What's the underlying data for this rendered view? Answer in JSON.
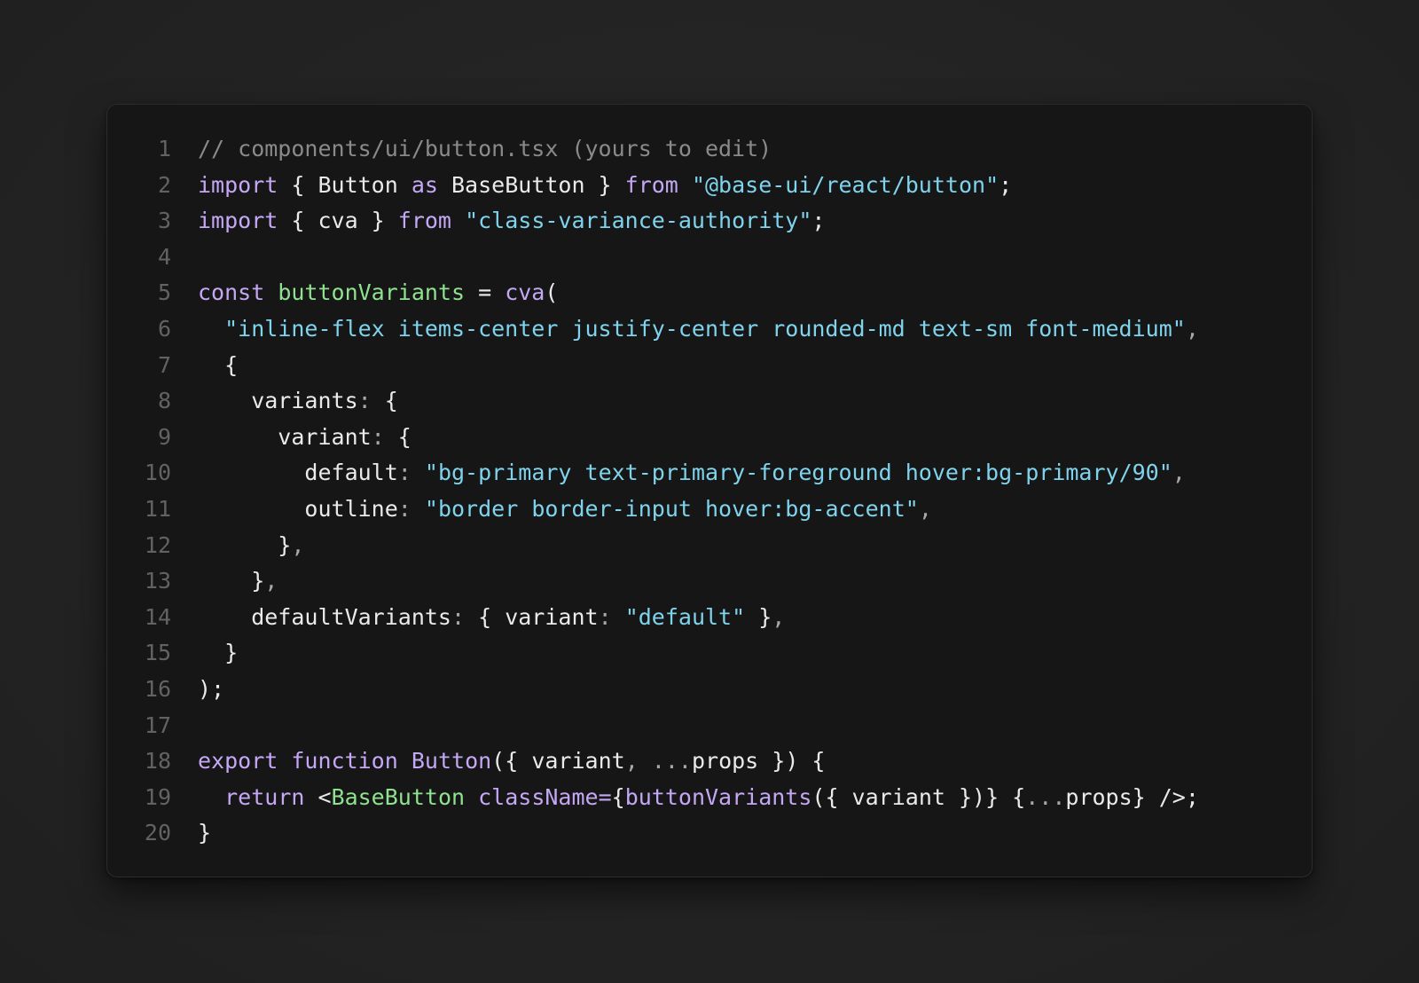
{
  "colors": {
    "page_background": "#242424",
    "card_background": "#161616",
    "line_number": "#626262",
    "comment": "#8a8a8a",
    "keyword": "#c4a7f5",
    "string": "#7fd3ec",
    "identifier": "#eaeaea",
    "declaration": "#8fe28f"
  },
  "lines": [
    {
      "n": "1",
      "tokens": [
        {
          "t": "// components/ui/button.tsx (yours to edit)",
          "k": "comment"
        }
      ]
    },
    {
      "n": "2",
      "tokens": [
        {
          "t": "import",
          "k": "keyword"
        },
        {
          "t": " { Button ",
          "k": "ident"
        },
        {
          "t": "as",
          "k": "keyword"
        },
        {
          "t": " BaseButton } ",
          "k": "ident"
        },
        {
          "t": "from",
          "k": "keyword"
        },
        {
          "t": " ",
          "k": "ident"
        },
        {
          "t": "\"@base-ui/react/button\"",
          "k": "string"
        },
        {
          "t": ";",
          "k": "ident"
        }
      ]
    },
    {
      "n": "3",
      "tokens": [
        {
          "t": "import",
          "k": "keyword"
        },
        {
          "t": " { cva } ",
          "k": "ident"
        },
        {
          "t": "from",
          "k": "keyword"
        },
        {
          "t": " ",
          "k": "ident"
        },
        {
          "t": "\"class-variance-authority\"",
          "k": "string"
        },
        {
          "t": ";",
          "k": "ident"
        }
      ]
    },
    {
      "n": "4",
      "tokens": []
    },
    {
      "n": "5",
      "tokens": [
        {
          "t": "const",
          "k": "keyword"
        },
        {
          "t": " ",
          "k": "ident"
        },
        {
          "t": "buttonVariants",
          "k": "decl"
        },
        {
          "t": " = ",
          "k": "ident"
        },
        {
          "t": "cva",
          "k": "call"
        },
        {
          "t": "(",
          "k": "ident"
        }
      ]
    },
    {
      "n": "6",
      "tokens": [
        {
          "t": "  ",
          "k": "ident"
        },
        {
          "t": "\"inline-flex items-center justify-center rounded-md text-sm font-medium\"",
          "k": "string"
        },
        {
          "t": ",",
          "k": "punct"
        }
      ]
    },
    {
      "n": "7",
      "tokens": [
        {
          "t": "  {",
          "k": "ident"
        }
      ]
    },
    {
      "n": "8",
      "tokens": [
        {
          "t": "    variants",
          "k": "ident"
        },
        {
          "t": ":",
          "k": "punct"
        },
        {
          "t": " {",
          "k": "ident"
        }
      ]
    },
    {
      "n": "9",
      "tokens": [
        {
          "t": "      variant",
          "k": "ident"
        },
        {
          "t": ":",
          "k": "punct"
        },
        {
          "t": " {",
          "k": "ident"
        }
      ]
    },
    {
      "n": "10",
      "tokens": [
        {
          "t": "        default",
          "k": "ident"
        },
        {
          "t": ":",
          "k": "punct"
        },
        {
          "t": " ",
          "k": "ident"
        },
        {
          "t": "\"bg-primary text-primary-foreground hover:bg-primary/90\"",
          "k": "string"
        },
        {
          "t": ",",
          "k": "punct"
        }
      ]
    },
    {
      "n": "11",
      "tokens": [
        {
          "t": "        outline",
          "k": "ident"
        },
        {
          "t": ":",
          "k": "punct"
        },
        {
          "t": " ",
          "k": "ident"
        },
        {
          "t": "\"border border-input hover:bg-accent\"",
          "k": "string"
        },
        {
          "t": ",",
          "k": "punct"
        }
      ]
    },
    {
      "n": "12",
      "tokens": [
        {
          "t": "      }",
          "k": "ident"
        },
        {
          "t": ",",
          "k": "punct"
        }
      ]
    },
    {
      "n": "13",
      "tokens": [
        {
          "t": "    }",
          "k": "ident"
        },
        {
          "t": ",",
          "k": "punct"
        }
      ]
    },
    {
      "n": "14",
      "tokens": [
        {
          "t": "    defaultVariants",
          "k": "ident"
        },
        {
          "t": ":",
          "k": "punct"
        },
        {
          "t": " { variant",
          "k": "ident"
        },
        {
          "t": ":",
          "k": "punct"
        },
        {
          "t": " ",
          "k": "ident"
        },
        {
          "t": "\"default\"",
          "k": "string"
        },
        {
          "t": " }",
          "k": "ident"
        },
        {
          "t": ",",
          "k": "punct"
        }
      ]
    },
    {
      "n": "15",
      "tokens": [
        {
          "t": "  }",
          "k": "ident"
        }
      ]
    },
    {
      "n": "16",
      "tokens": [
        {
          "t": ");",
          "k": "ident"
        }
      ]
    },
    {
      "n": "17",
      "tokens": []
    },
    {
      "n": "18",
      "tokens": [
        {
          "t": "export",
          "k": "keyword"
        },
        {
          "t": " ",
          "k": "ident"
        },
        {
          "t": "function",
          "k": "keyword"
        },
        {
          "t": " ",
          "k": "ident"
        },
        {
          "t": "Button",
          "k": "call"
        },
        {
          "t": "({ variant",
          "k": "ident"
        },
        {
          "t": ",",
          "k": "punct"
        },
        {
          "t": " ",
          "k": "ident"
        },
        {
          "t": "...",
          "k": "punct"
        },
        {
          "t": "props }) {",
          "k": "ident"
        }
      ]
    },
    {
      "n": "19",
      "tokens": [
        {
          "t": "  ",
          "k": "ident"
        },
        {
          "t": "return",
          "k": "keyword"
        },
        {
          "t": " <",
          "k": "ident"
        },
        {
          "t": "BaseButton",
          "k": "jsx"
        },
        {
          "t": " ",
          "k": "ident"
        },
        {
          "t": "className=",
          "k": "attr"
        },
        {
          "t": "{",
          "k": "ident"
        },
        {
          "t": "buttonVariants",
          "k": "call"
        },
        {
          "t": "({ variant })} {",
          "k": "ident"
        },
        {
          "t": "...",
          "k": "punct"
        },
        {
          "t": "props} />;",
          "k": "ident"
        }
      ]
    },
    {
      "n": "20",
      "tokens": [
        {
          "t": "}",
          "k": "ident"
        }
      ]
    }
  ]
}
